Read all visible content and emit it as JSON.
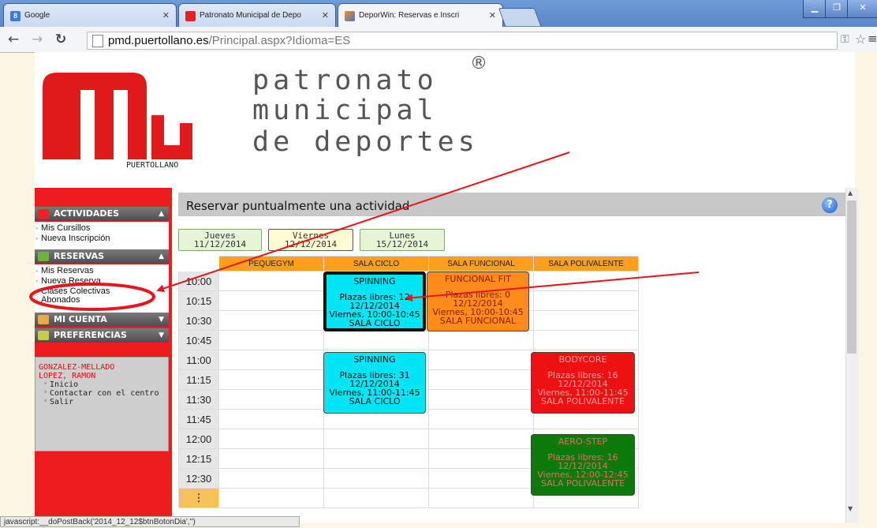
{
  "browser": {
    "tabs": [
      {
        "label": "Google",
        "icon": "google-icon",
        "active": false
      },
      {
        "label": "Patronato Municipal de Depo",
        "icon": "pmd-favicon",
        "active": false
      },
      {
        "label": "DeporWin: Reservas e Inscri",
        "icon": "deporwin-favicon",
        "active": true
      }
    ],
    "url_domain": "pmd.puertollano.es",
    "url_path": "/Principal.aspx?Idioma=ES",
    "status_text": "javascript:__doPostBack('2014_12_12$btnBotonDia','')"
  },
  "header": {
    "logo_caption": "PUERTOLLANO",
    "title_line1": "patronato",
    "title_line2": "municipal",
    "title_line3": "de deportes",
    "registered_mark": "®"
  },
  "sidebar": {
    "actividades": {
      "label": "ACTIVIDADES",
      "items": [
        "Mis Cursillos",
        "Nueva Inscripción"
      ]
    },
    "reservas": {
      "label": "RESERVAS",
      "items": [
        "Mis Reservas",
        "Nueva Reserva",
        "Clases Colectivas",
        "Abonados"
      ]
    },
    "mi_cuenta": {
      "label": "MI CUENTA"
    },
    "preferencias": {
      "label": "PREFERENCIAS"
    },
    "user": {
      "name_line1": "GONZALEZ-MELLADO",
      "name_line2": "LOPEZ, RAMON",
      "links": [
        "Inicio",
        "Contactar con el centro",
        "Salir"
      ]
    }
  },
  "main": {
    "title": "Reservar puntualmente una actividad",
    "help": "?",
    "days": [
      {
        "weekday": "Jueves",
        "date": "11/12/2014",
        "selected": false
      },
      {
        "weekday": "Viernes",
        "date": "12/12/2014",
        "selected": true
      },
      {
        "weekday": "Lunes",
        "date": "15/12/2014",
        "selected": false
      }
    ],
    "columns": [
      "PEQUEGYM",
      "SALA CICLO",
      "SALA FUNCIONAL",
      "SALA POLIVALENTE"
    ],
    "times": [
      "10:00",
      "10:15",
      "10:30",
      "10:45",
      "11:00",
      "11:15",
      "11:30",
      "11:45",
      "12:00",
      "12:15",
      "12:30"
    ],
    "more_label": "⋮",
    "slots": [
      {
        "name": "SPINNING",
        "plazas": "Plazas libres: 12",
        "date": "12/12/2014",
        "hours": "Viernes, 10:00-10:45",
        "room": "SALA CICLO",
        "color": "#00e6f5",
        "text_color": "#111",
        "selected": true
      },
      {
        "name": "FUNCIONAL FIT",
        "plazas": "Plazas libres: 0",
        "date": "12/12/2014",
        "hours": "Viernes, 10:00-10:45",
        "room": "SALA FUNCIONAL",
        "color": "#ff8c1a",
        "text_color": "#8a1a00",
        "selected": false
      },
      {
        "name": "SPINNING",
        "plazas": "Plazas libres: 31",
        "date": "12/12/2014",
        "hours": "Viernes, 11:00-11:45",
        "room": "SALA CICLO",
        "color": "#00e6f5",
        "text_color": "#111",
        "selected": false
      },
      {
        "name": "BODYCORE",
        "plazas": "Plazas libres: 16",
        "date": "12/12/2014",
        "hours": "Viernes, 11:00-11:45",
        "room": "SALA POLIVALENTE",
        "color": "#ee1111",
        "text_color": "#f3a0a0",
        "selected": false
      },
      {
        "name": "AERO-STEP",
        "plazas": "Plazas libres: 16",
        "date": "12/12/2014",
        "hours": "Viernes, 12:00-12:45",
        "room": "SALA POLIVALENTE",
        "color": "#0a7a0a",
        "text_color": "#e86a6a",
        "selected": false
      }
    ]
  },
  "colors": {
    "accent_red": "#ee1c1c",
    "header_orange": "#ff9f1a",
    "annotation_red": "#e8161c"
  }
}
